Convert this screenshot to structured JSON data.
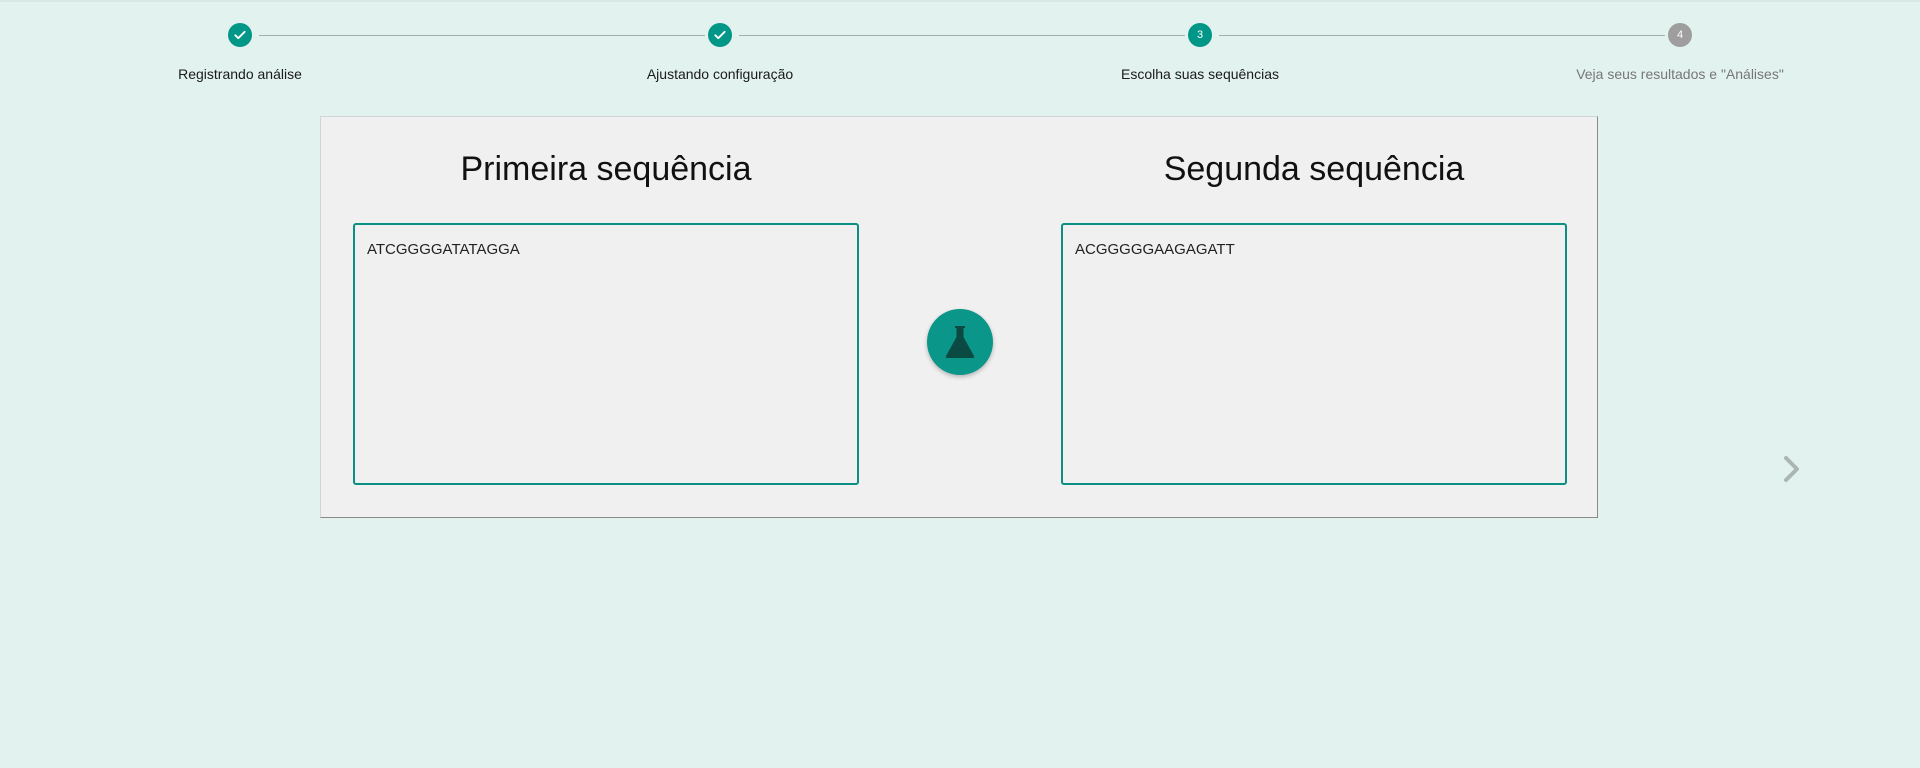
{
  "stepper": {
    "steps": [
      {
        "number": "",
        "state": "done",
        "label": "Registrando análise",
        "icon": "check-icon"
      },
      {
        "number": "",
        "state": "done",
        "label": "Ajustando configuração",
        "icon": "check-icon"
      },
      {
        "number": "3",
        "state": "active",
        "label": "Escolha suas sequências"
      },
      {
        "number": "4",
        "state": "pending",
        "label": "Veja seus resultados e \"Análises\""
      }
    ]
  },
  "sequences": {
    "first": {
      "title": "Primeira sequência",
      "value": "ATCGGGGATATAGGA"
    },
    "second": {
      "title": "Segunda sequência",
      "value": "ACGGGGGAAGAGATT"
    }
  },
  "actions": {
    "analyze_icon": "flask-icon",
    "next_icon": "chevron-right-icon"
  },
  "colors": {
    "background": "#e2f2ee",
    "accent": "#009688",
    "pending": "#9e9e9e",
    "card": "#f0f0f0"
  }
}
